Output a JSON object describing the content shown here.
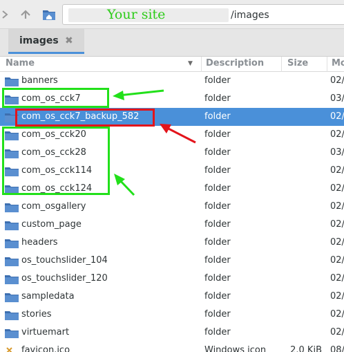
{
  "address": {
    "site_overlay": "Your site",
    "path": "/images"
  },
  "tab": {
    "label": "images",
    "close_glyph": "✖"
  },
  "columns": {
    "name": "Name",
    "description": "Description",
    "size": "Size",
    "modified": "Mo"
  },
  "rows": [
    {
      "name": "banners",
      "desc": "folder",
      "size": "",
      "mod": "02/",
      "icon": "folder-icon"
    },
    {
      "name": "com_os_cck7",
      "desc": "folder",
      "size": "",
      "mod": "03/",
      "icon": "folder-icon"
    },
    {
      "name": "com_os_cck7_backup_582",
      "desc": "folder",
      "size": "",
      "mod": "02/",
      "icon": "folder-icon",
      "selected": true
    },
    {
      "name": "com_os_cck20",
      "desc": "folder",
      "size": "",
      "mod": "02/",
      "icon": "folder-icon"
    },
    {
      "name": "com_os_cck28",
      "desc": "folder",
      "size": "",
      "mod": "03/",
      "icon": "folder-icon"
    },
    {
      "name": "com_os_cck114",
      "desc": "folder",
      "size": "",
      "mod": "02/",
      "icon": "folder-icon"
    },
    {
      "name": "com_os_cck124",
      "desc": "folder",
      "size": "",
      "mod": "02/",
      "icon": "folder-icon"
    },
    {
      "name": "com_osgallery",
      "desc": "folder",
      "size": "",
      "mod": "02/",
      "icon": "folder-icon"
    },
    {
      "name": "custom_page",
      "desc": "folder",
      "size": "",
      "mod": "02/",
      "icon": "folder-icon"
    },
    {
      "name": "headers",
      "desc": "folder",
      "size": "",
      "mod": "02/",
      "icon": "folder-icon"
    },
    {
      "name": "os_touchslider_104",
      "desc": "folder",
      "size": "",
      "mod": "02/",
      "icon": "folder-icon"
    },
    {
      "name": "os_touchslider_120",
      "desc": "folder",
      "size": "",
      "mod": "02/",
      "icon": "folder-icon"
    },
    {
      "name": "sampledata",
      "desc": "folder",
      "size": "",
      "mod": "02/",
      "icon": "folder-icon"
    },
    {
      "name": "stories",
      "desc": "folder",
      "size": "",
      "mod": "02/",
      "icon": "folder-icon"
    },
    {
      "name": "virtuemart",
      "desc": "folder",
      "size": "",
      "mod": "02/",
      "icon": "folder-icon"
    },
    {
      "name": "favicon.ico",
      "desc": "Windows icon",
      "size": "2.0 KiB",
      "mod": "08/",
      "icon": "image-file-icon"
    }
  ],
  "colors": {
    "selection": "#4a90d9",
    "annotation_green": "#22e01a",
    "annotation_red": "#e3141b",
    "folder_blue": "#5a8fd0"
  }
}
